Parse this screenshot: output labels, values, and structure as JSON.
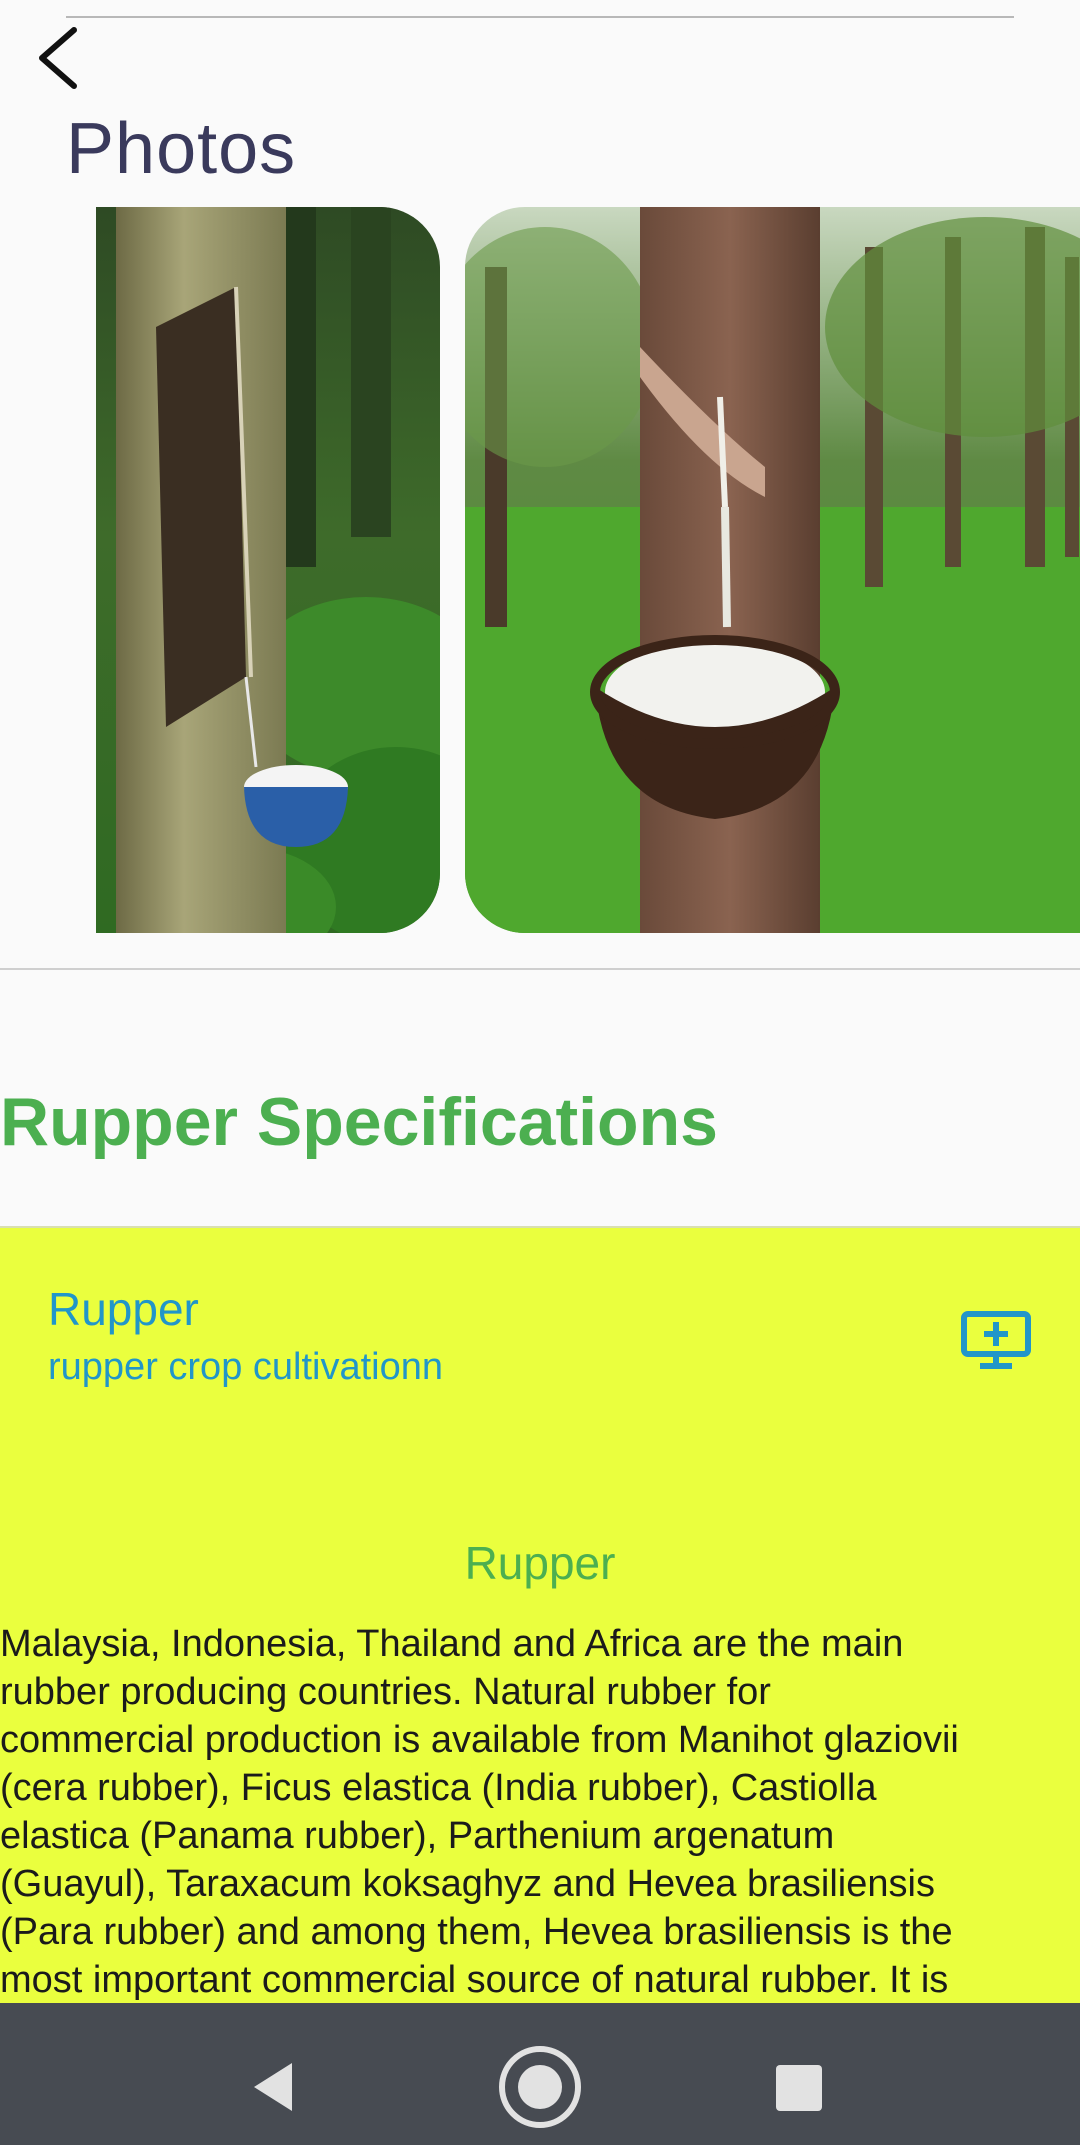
{
  "header": {
    "back_icon": "chevron-left-icon",
    "title": "Photos"
  },
  "gallery": {
    "photos": [
      {
        "subject": "rubber tree tapped with latex cup"
      },
      {
        "subject": "rubber plantation with latex cup on tree"
      }
    ]
  },
  "section": {
    "title": "Rupper Specifications"
  },
  "card": {
    "title": "Rupper",
    "subtitle": "rupper crop cultivationn",
    "action_icon": "add-to-screen-icon",
    "background": "#eaff3e",
    "accent": "#2196c9"
  },
  "detail": {
    "title": "Rupper",
    "lines": [
      "Malaysia, Indonesia, Thailand and Africa are the main",
      "rubber producing countries. Natural rubber for",
      "commercial production is available from Manihot glaziovii",
      "(cera rubber), Ficus elastica (India rubber), Castiolla",
      "elastica (Panama rubber), Parthenium argenatum",
      "(Guayul), Taraxacum koksaghyz and Hevea brasiliensis",
      "(Para rubber) and among them, Hevea brasiliensis is the",
      "most important commercial source of natural rubber. It is"
    ]
  },
  "navbar": {
    "back_icon": "nav-back-icon",
    "home_icon": "nav-home-icon",
    "recents_icon": "nav-recents-icon"
  }
}
